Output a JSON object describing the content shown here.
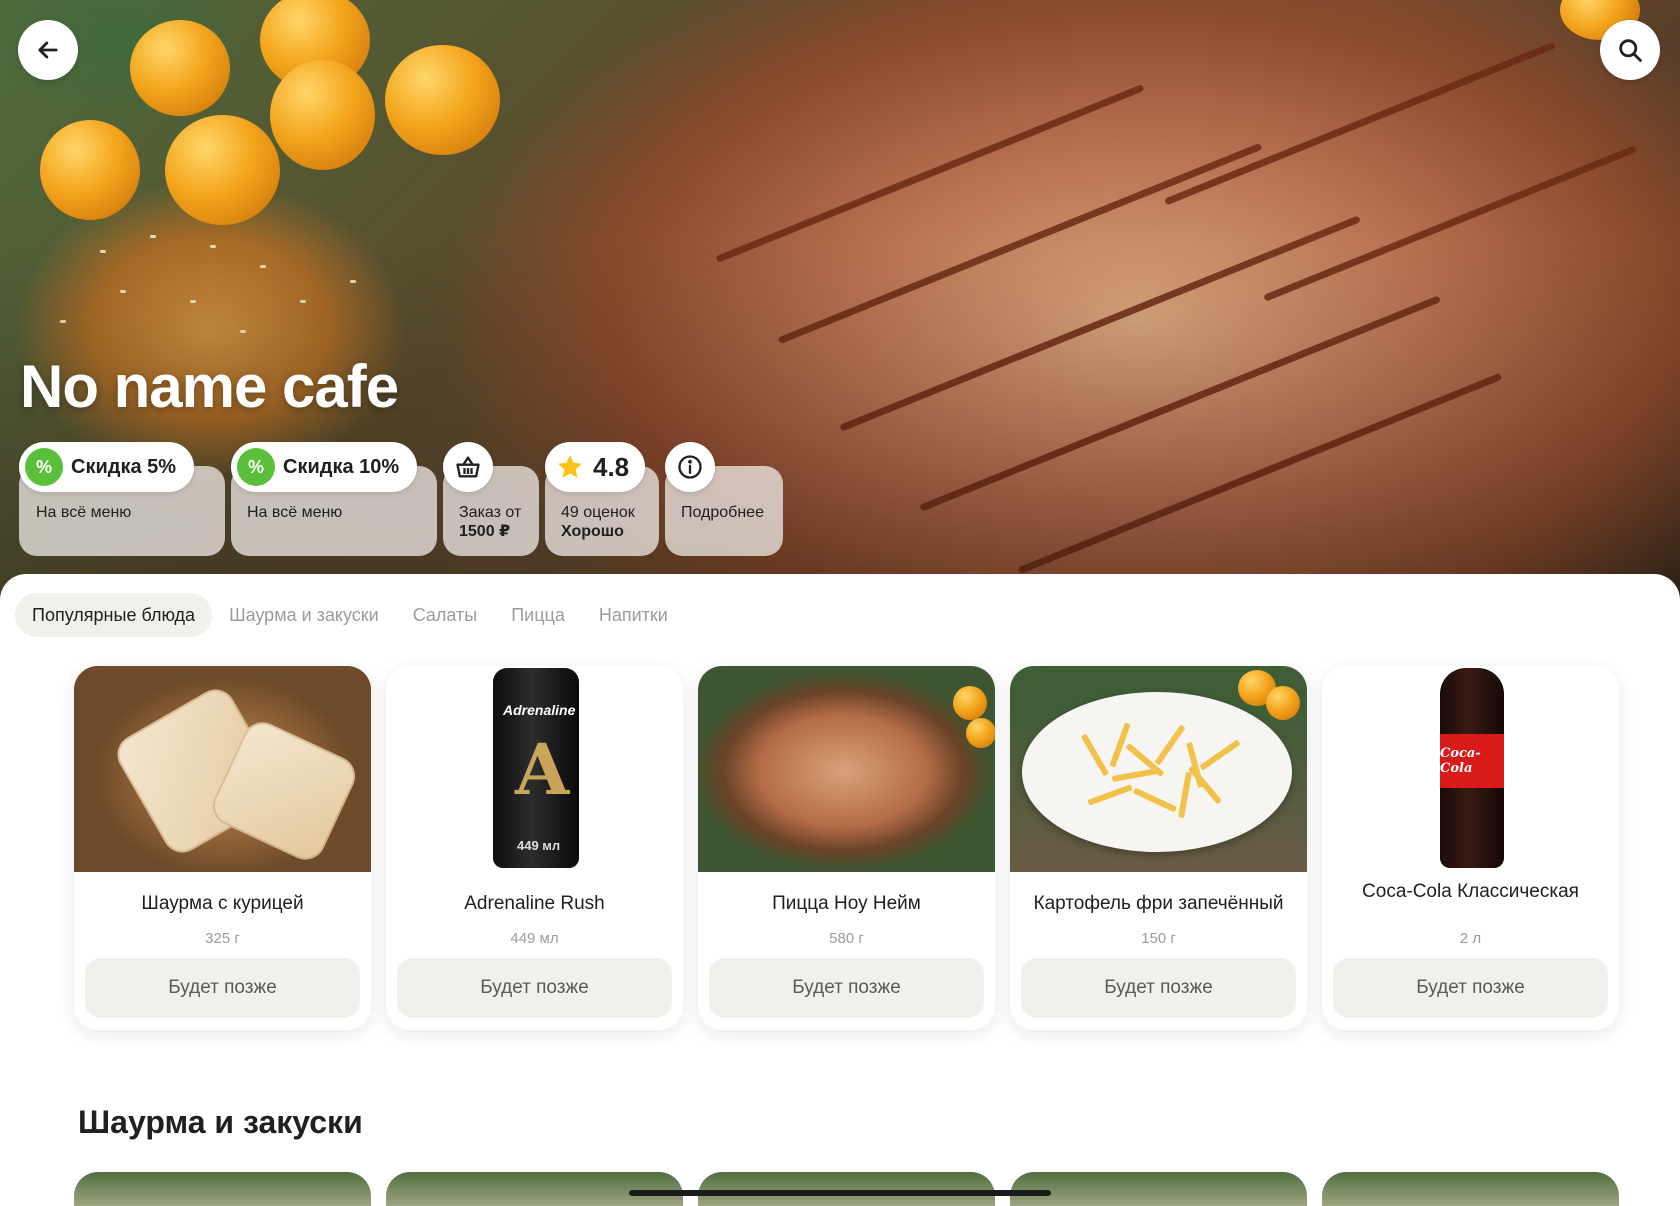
{
  "hero": {
    "title": "No name cafe",
    "back_icon": "arrow-left-icon",
    "search_icon": "search-icon"
  },
  "chips": {
    "discount1": {
      "label": "Скидка 5%",
      "sub": "На всё меню",
      "icon": "percent-icon"
    },
    "discount2": {
      "label": "Скидка 10%",
      "sub": "На всё меню",
      "icon": "percent-icon"
    },
    "min_order": {
      "line1": "Заказ от",
      "line2": "1500 ₽",
      "icon": "basket-icon"
    },
    "rating": {
      "value": "4.8",
      "line1": "49 оценок",
      "line2": "Хорошо",
      "icon": "star-icon"
    },
    "info": {
      "label": "Подробнее",
      "icon": "info-icon"
    }
  },
  "tabs": [
    {
      "label": "Популярные блюда",
      "active": true
    },
    {
      "label": "Шаурма и закуски",
      "active": false
    },
    {
      "label": "Салаты",
      "active": false
    },
    {
      "label": "Пицца",
      "active": false
    },
    {
      "label": "Напитки",
      "active": false
    }
  ],
  "popular": [
    {
      "name": "Шаурма с курицей",
      "weight": "325 г",
      "button": "Будет позже"
    },
    {
      "name": "Adrenaline Rush",
      "weight": "449 мл",
      "button": "Будет позже",
      "can_label": "Adrenaline",
      "can_volume": "449 мл"
    },
    {
      "name": "Пицца Ноу Нейм",
      "weight": "580 г",
      "button": "Будет позже"
    },
    {
      "name": "Картофель фри запечённый",
      "weight": "150 г",
      "button": "Будет позже"
    },
    {
      "name": "Coca-Cola Классическая",
      "weight": "2 л",
      "button": "Будет позже",
      "bottle_label": "Coca-Cola"
    }
  ],
  "section2": {
    "title": "Шаурма и закуски"
  },
  "colors": {
    "accent_green": "#5ac03a",
    "tab_active_bg": "#f2f0ed",
    "muted_text": "#9e9b98"
  }
}
